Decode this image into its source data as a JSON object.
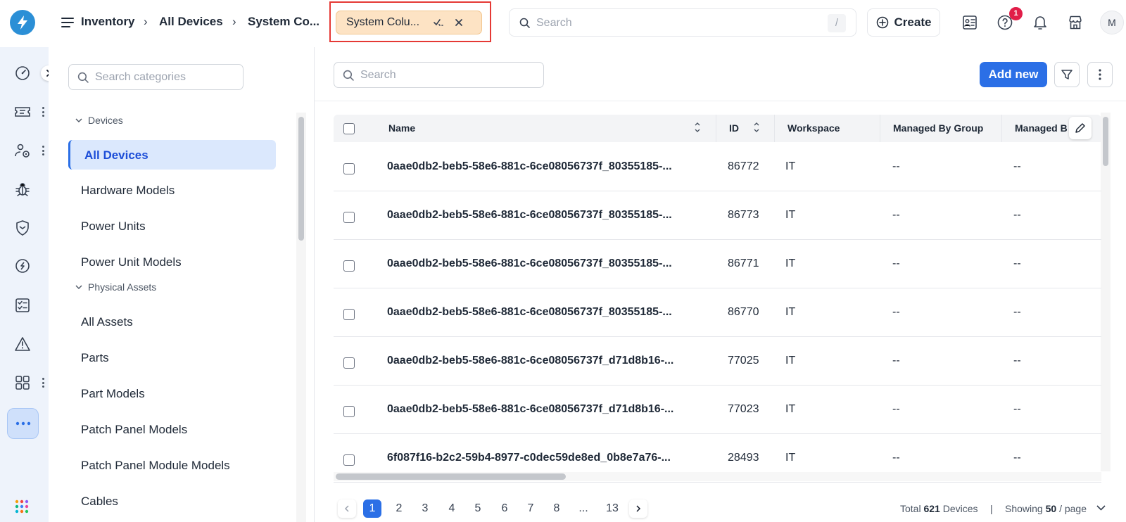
{
  "header": {
    "breadcrumb": [
      "Inventory",
      "All Devices",
      "System Co..."
    ],
    "active_tab": "System Colu...",
    "search_placeholder": "Search",
    "search_shortcut": "/",
    "create_label": "Create",
    "help_badge": "1",
    "avatar_initial": "M"
  },
  "categories": {
    "search_placeholder": "Search categories",
    "groups": [
      {
        "label": "Devices",
        "items": [
          "All Devices",
          "Hardware Models",
          "Power Units",
          "Power Unit Models"
        ]
      },
      {
        "label": "Physical Assets",
        "items": [
          "All Assets",
          "Parts",
          "Part Models",
          "Patch Panel Models",
          "Patch Panel Module Models",
          "Cables"
        ]
      }
    ],
    "selected": "All Devices"
  },
  "main": {
    "search_placeholder": "Search",
    "add_label": "Add new"
  },
  "table": {
    "columns": [
      "Name",
      "ID",
      "Workspace",
      "Managed By Group",
      "Managed B"
    ],
    "rows": [
      {
        "name": "0aae0db2-beb5-58e6-881c-6ce08056737f_80355185-...",
        "id": "86772",
        "workspace": "IT",
        "group": "--",
        "managed": "--"
      },
      {
        "name": "0aae0db2-beb5-58e6-881c-6ce08056737f_80355185-...",
        "id": "86773",
        "workspace": "IT",
        "group": "--",
        "managed": "--"
      },
      {
        "name": "0aae0db2-beb5-58e6-881c-6ce08056737f_80355185-...",
        "id": "86771",
        "workspace": "IT",
        "group": "--",
        "managed": "--"
      },
      {
        "name": "0aae0db2-beb5-58e6-881c-6ce08056737f_80355185-...",
        "id": "86770",
        "workspace": "IT",
        "group": "--",
        "managed": "--"
      },
      {
        "name": "0aae0db2-beb5-58e6-881c-6ce08056737f_d71d8b16-...",
        "id": "77025",
        "workspace": "IT",
        "group": "--",
        "managed": "--"
      },
      {
        "name": "0aae0db2-beb5-58e6-881c-6ce08056737f_d71d8b16-...",
        "id": "77023",
        "workspace": "IT",
        "group": "--",
        "managed": "--"
      },
      {
        "name": "6f087f16-b2c2-59b4-8977-c0dec59de8ed_0b8e7a76-...",
        "id": "28493",
        "workspace": "IT",
        "group": "--",
        "managed": "--"
      }
    ]
  },
  "pagination": {
    "pages": [
      "1",
      "2",
      "3",
      "4",
      "5",
      "6",
      "7",
      "8",
      "...",
      "13"
    ],
    "current": "1",
    "total_prefix": "Total",
    "total_count": "621",
    "total_suffix": "Devices",
    "divider": "|",
    "showing_prefix": "Showing",
    "page_size": "50",
    "page_suffix": "/ page"
  },
  "colors": {
    "accent": "#2b6fe6",
    "tab_bg": "#fde3c4",
    "highlight_border": "#e53935",
    "rail_bg": "#eef3fb",
    "badge": "#e11d48"
  }
}
